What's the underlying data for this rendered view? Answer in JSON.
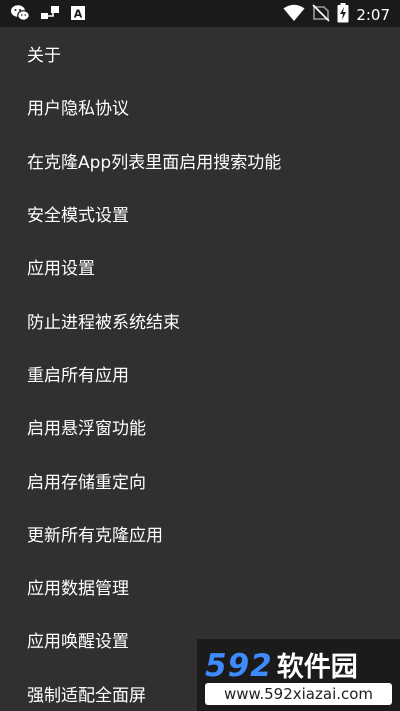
{
  "status_bar": {
    "time": "2:07",
    "left_icons": [
      "wechat-icon",
      "usb-transfer-icon",
      "keyboard-a-icon"
    ],
    "right_icons": [
      "wifi-icon",
      "no-sim-icon",
      "battery-charging-icon"
    ]
  },
  "menu": {
    "items": [
      {
        "label": "关于"
      },
      {
        "label": "用户隐私协议"
      },
      {
        "label": "在克隆App列表里面启用搜索功能"
      },
      {
        "label": "安全模式设置"
      },
      {
        "label": "应用设置"
      },
      {
        "label": "防止进程被系统结束"
      },
      {
        "label": "重启所有应用"
      },
      {
        "label": "启用悬浮窗功能"
      },
      {
        "label": "启用存储重定向"
      },
      {
        "label": "更新所有克隆应用"
      },
      {
        "label": "应用数据管理"
      },
      {
        "label": "应用唤醒设置"
      },
      {
        "label": "强制适配全面屏"
      }
    ]
  },
  "watermark": {
    "number": "592",
    "name": "软件园",
    "url": "www.592xiazai.com"
  },
  "colors": {
    "background": "#303030",
    "status_bar": "#1a1a1a",
    "text": "#ffffff",
    "watermark_accent": "#3d8bff"
  }
}
